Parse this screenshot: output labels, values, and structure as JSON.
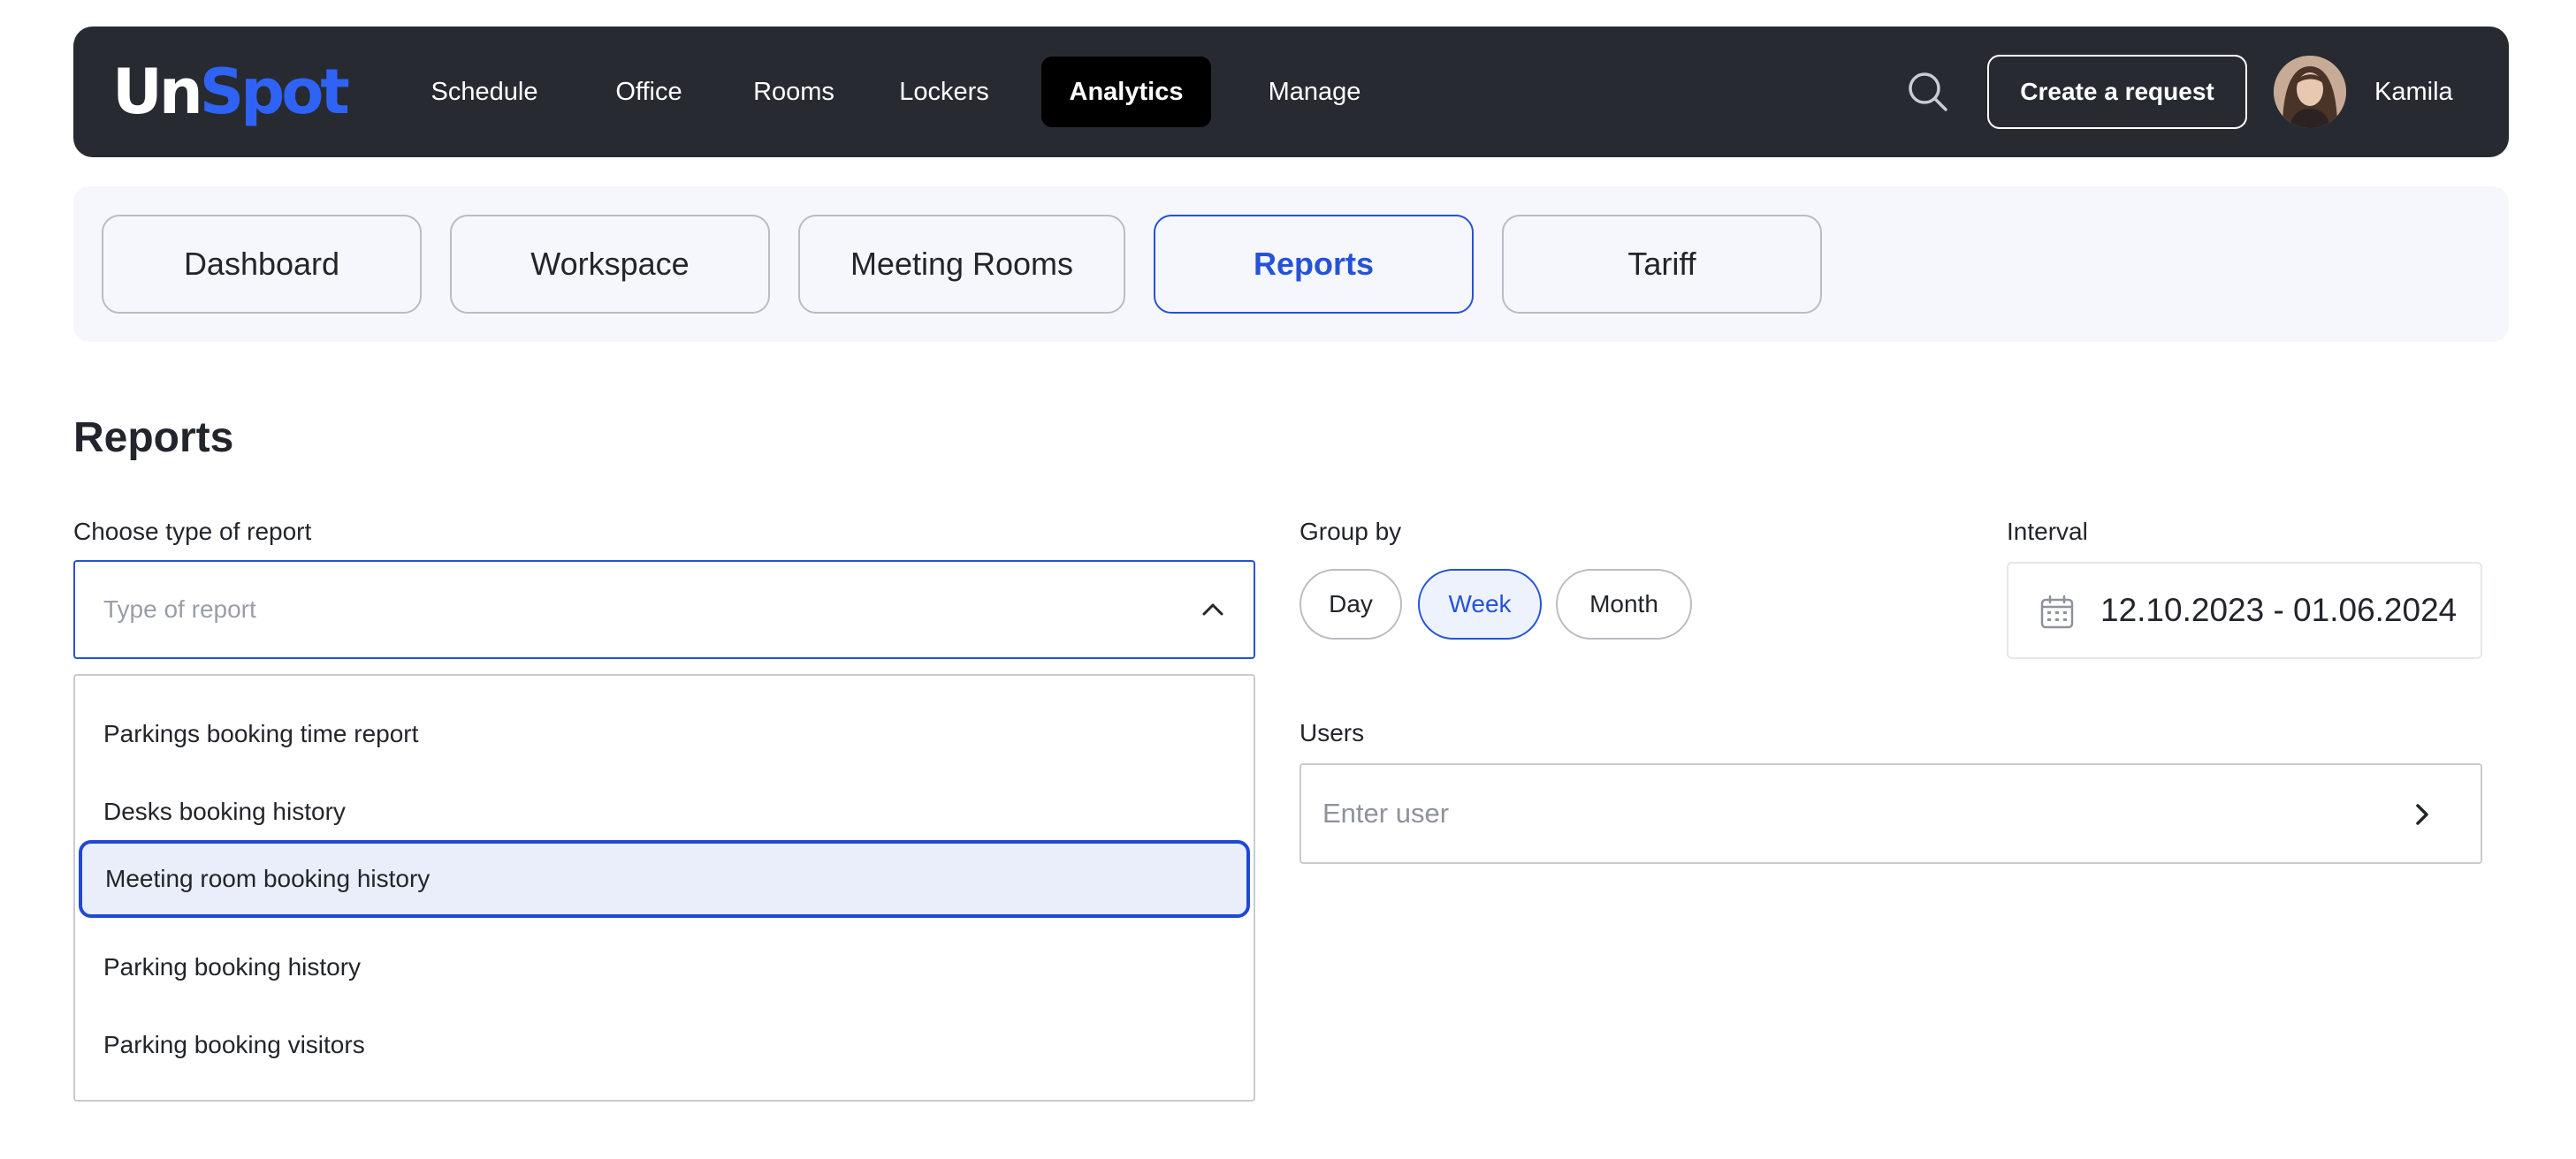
{
  "header": {
    "logo": {
      "part1": "Un",
      "part2": "Spot"
    },
    "nav": [
      {
        "label": "Schedule",
        "active": false
      },
      {
        "label": "Office",
        "active": false
      },
      {
        "label": "Rooms",
        "active": false
      },
      {
        "label": "Lockers",
        "active": false
      },
      {
        "label": "Analytics",
        "active": true
      },
      {
        "label": "Manage",
        "active": false
      }
    ],
    "search_icon": "search-icon",
    "create_label": "Create a request",
    "user_name": "Kamila"
  },
  "subtabs": [
    {
      "label": "Dashboard",
      "active": false
    },
    {
      "label": "Workspace",
      "active": false
    },
    {
      "label": "Meeting Rooms",
      "active": false
    },
    {
      "label": "Reports",
      "active": true
    },
    {
      "label": "Tariff",
      "active": false
    }
  ],
  "page": {
    "title": "Reports"
  },
  "report_type": {
    "label": "Choose type of report",
    "placeholder": "Type of report",
    "expanded": true,
    "options": [
      {
        "label": "Parkings booking time report",
        "selected": false
      },
      {
        "label": "Desks booking history",
        "selected": false
      },
      {
        "label": "Meeting room booking history",
        "selected": true
      },
      {
        "label": "Parking booking history",
        "selected": false
      },
      {
        "label": "Parking booking visitors",
        "selected": false
      }
    ]
  },
  "group_by": {
    "label": "Group by",
    "options": [
      {
        "label": "Day",
        "active": false
      },
      {
        "label": "Week",
        "active": true
      },
      {
        "label": "Month",
        "active": false
      }
    ]
  },
  "interval": {
    "label": "Interval",
    "value": "12.10.2023 - 01.06.2024",
    "icon": "calendar-icon"
  },
  "users": {
    "label": "Users",
    "placeholder": "Enter user"
  },
  "colors": {
    "accent": "#2453d8",
    "brand": "#2f63f5",
    "nav_bg": "#272a31"
  }
}
